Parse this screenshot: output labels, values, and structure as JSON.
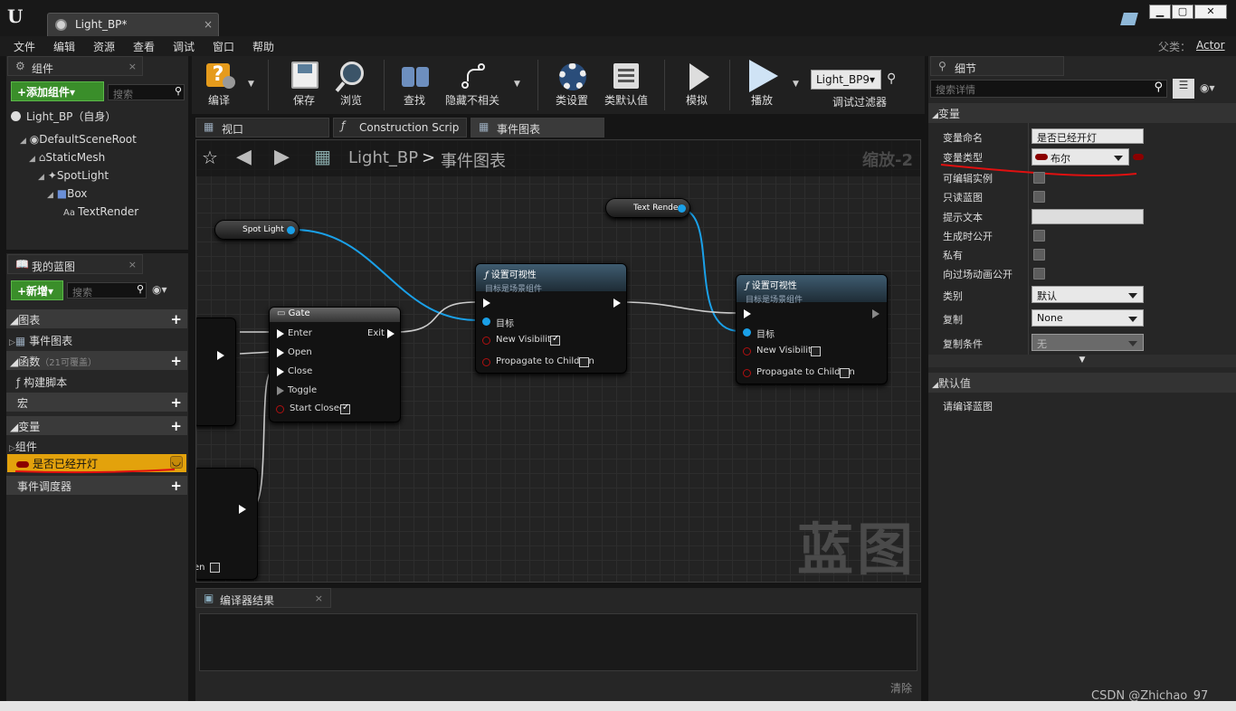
{
  "window": {
    "tab_title": "Light_BP*",
    "close_tab": "×",
    "min": "▁",
    "max": "▢",
    "close": "✕"
  },
  "menu": [
    "文件",
    "编辑",
    "资源",
    "查看",
    "调试",
    "窗口",
    "帮助"
  ],
  "parent_class": {
    "label": "父类：",
    "value": "Actor"
  },
  "components": {
    "tab": "组件",
    "add_button": "+添加组件▾",
    "search_placeholder": "搜索",
    "self": "Light_BP（自身）",
    "tree": [
      "DefaultSceneRoot",
      "StaticMesh",
      "SpotLight",
      "Box",
      "TextRender"
    ]
  },
  "myblueprint": {
    "tab": "我的蓝图",
    "new_button": "+新增▾",
    "search_placeholder": "搜索",
    "graphs": "图表",
    "event_graph": "事件图表",
    "functions": "函数",
    "functions_count": "（21可覆盖）",
    "construction": "构建脚本",
    "macros": "宏",
    "variables": "变量",
    "components": "组件",
    "selected_var": "是否已经开灯",
    "dispatchers": "事件调度器"
  },
  "toolbar": {
    "compile": "编译",
    "save": "保存",
    "browse": "浏览",
    "find": "查找",
    "hide": "隐藏不相关",
    "class_settings": "类设置",
    "class_defaults": "类默认值",
    "simulate": "模拟",
    "play": "播放",
    "debug_object": "Light_BP9▾",
    "debug_filter": "调试过滤器"
  },
  "graph_tabs": [
    "视口",
    "Construction Scrip",
    "事件图表"
  ],
  "graph": {
    "breadcrumb_bp": "Light_BP",
    "breadcrumb_sep": ">",
    "breadcrumb_graph": "事件图表",
    "zoom": "缩放-2",
    "watermark": "蓝图",
    "spot_light": "Spot Light",
    "text_render": "Text Render",
    "gate": {
      "title": "Gate",
      "enter": "Enter",
      "open": "Open",
      "close": "Close",
      "toggle": "Toggle",
      "start_closed": "Start Closed",
      "exit": "Exit"
    },
    "setvis1": {
      "title": "设置可视性",
      "subtitle": "目标是场景组件",
      "target": "目标",
      "new_vis": "New Visibility",
      "propagate": "Propagate to Children"
    },
    "setvis2": {
      "title": "设置可视性",
      "subtitle": "目标是场景组件",
      "target": "目标",
      "new_vis": "New Visibility",
      "propagate": "Propagate to Children"
    },
    "partial_text": "en"
  },
  "compiler": {
    "tab": "编译器结果",
    "clear": "清除"
  },
  "details": {
    "tab": "细节",
    "search_placeholder": "搜索详情",
    "section_var": "变量",
    "rows": {
      "name_label": "变量命名",
      "name_value": "是否已经开灯",
      "type_label": "变量类型",
      "type_value": "布尔",
      "editable": "可编辑实例",
      "readonly": "只读蓝图",
      "tooltip": "提示文本",
      "expose_spawn": "生成时公开",
      "private": "私有",
      "expose_cine": "向过场动画公开",
      "category_label": "类别",
      "category_value": "默认",
      "replication_label": "复制",
      "replication_value": "None",
      "repcond_label": "复制条件",
      "repcond_value": "无"
    },
    "section_default": "默认值",
    "default_msg": "请编译蓝图"
  },
  "watermark_csdn": "CSDN @Zhichao_97",
  "colors": {
    "accent_green": "#3a8e2a",
    "selected_var": "#e3a20c",
    "pin_blue": "#1aa0e8",
    "bool_red": "#8b0000",
    "annotation_red": "#e01010"
  }
}
